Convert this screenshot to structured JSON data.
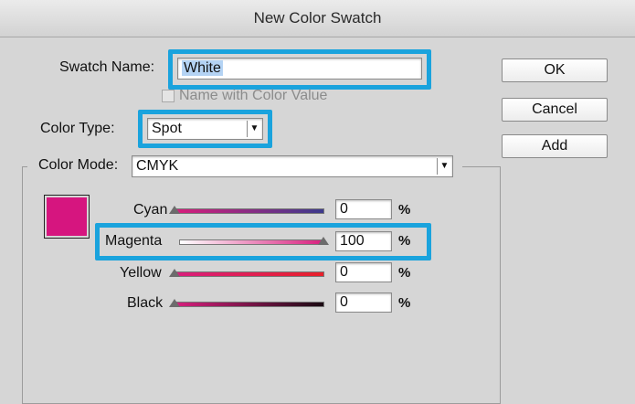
{
  "window": {
    "title": "New Color Swatch"
  },
  "swatch_name": {
    "label": "Swatch Name:",
    "value": "White"
  },
  "name_with_color_value": {
    "label": "Name with Color Value",
    "checked": false
  },
  "color_type": {
    "label": "Color Type:",
    "value": "Spot"
  },
  "color_mode": {
    "label": "Color Mode:",
    "value": "CMYK"
  },
  "buttons": {
    "ok": "OK",
    "cancel": "Cancel",
    "add": "Add"
  },
  "preview_color": "#d6157f",
  "highlight_color": "#1aa3dd",
  "sliders": [
    {
      "label": "Cyan",
      "value": "0",
      "unit": "%",
      "level": 0
    },
    {
      "label": "Magenta",
      "value": "100",
      "unit": "%",
      "level": 1
    },
    {
      "label": "Yellow",
      "value": "0",
      "unit": "%",
      "level": 0
    },
    {
      "label": "Black",
      "value": "0",
      "unit": "%",
      "level": 0
    }
  ]
}
